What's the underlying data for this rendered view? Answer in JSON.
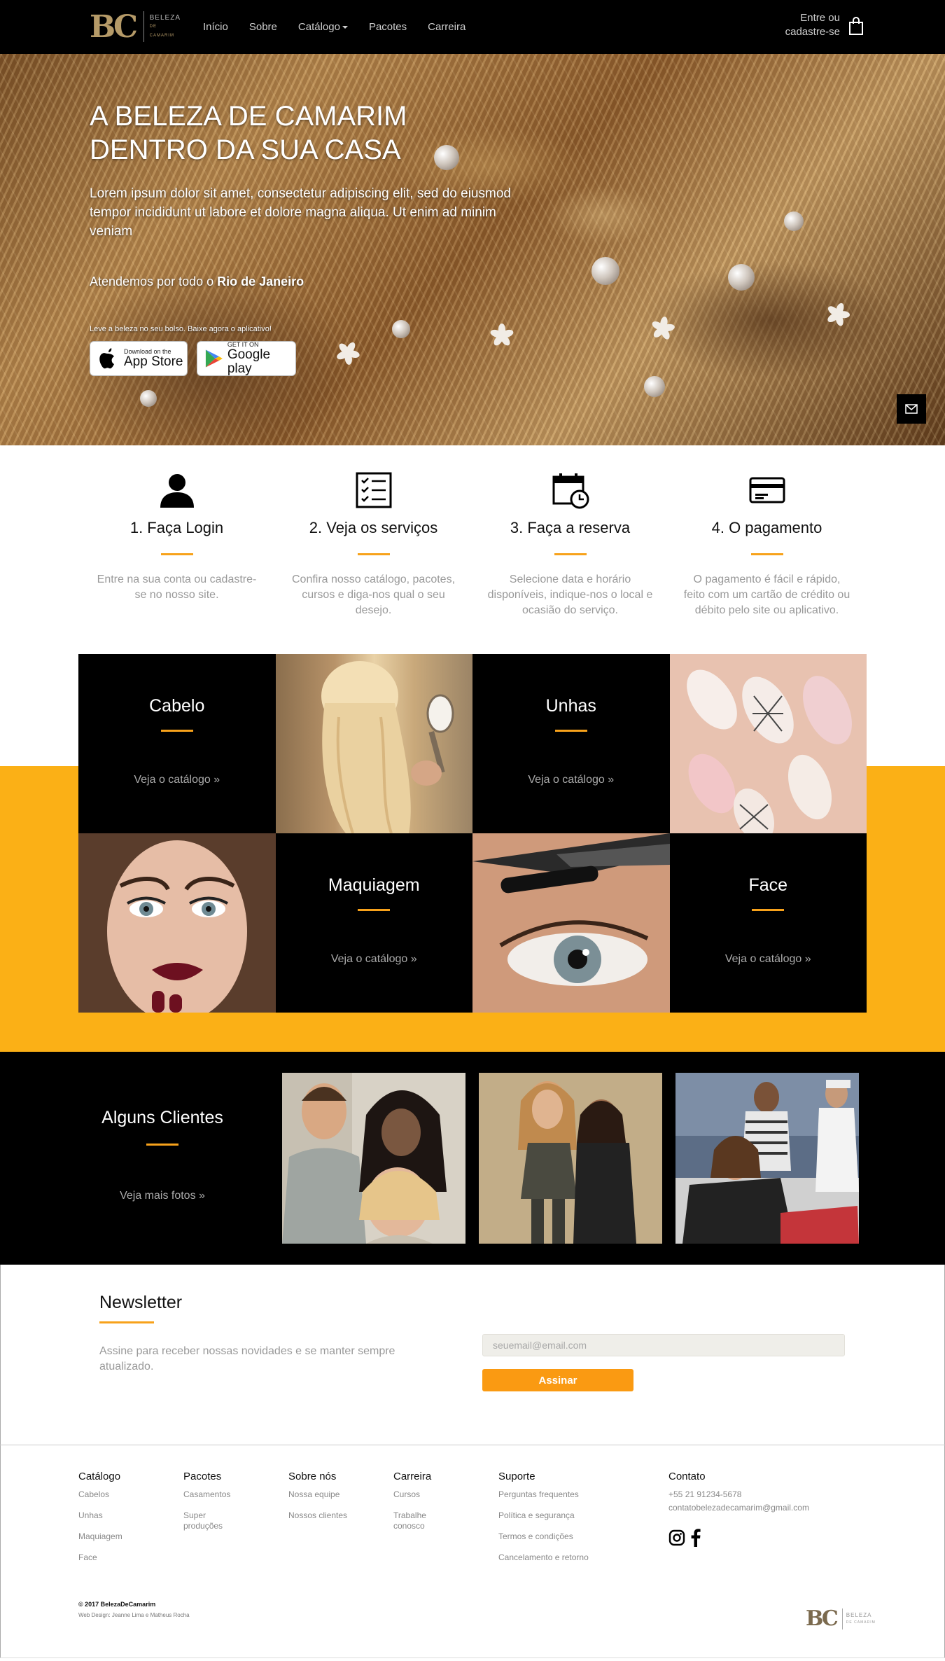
{
  "nav": {
    "logo_mark": "BC",
    "logo_name": "BELEZA",
    "logo_sub": "DE CAMARIM",
    "items": [
      "Início",
      "Sobre",
      "Catálogo",
      "Pacotes",
      "Carreira"
    ],
    "login_line1": "Entre ou",
    "login_line2": "cadastre-se"
  },
  "hero": {
    "title_line1": "A BELEZA DE CAMARIM",
    "title_line2": "DENTRO DA SUA CASA",
    "description": "Lorem ipsum dolor sit amet, consectetur adipiscing elit, sed do eiusmod tempor incididunt ut labore et dolore magna aliqua. Ut enim ad minim veniam",
    "served_prefix": "Atendemos por todo o ",
    "served_place": "Rio de Janeiro",
    "app_text": "Leve a beleza no seu bolso. Baixe agora o aplicativo!",
    "appstore_small": "Download on the",
    "appstore_big": "App Store",
    "google_small": "GET IT ON",
    "google_big": "Google play"
  },
  "steps": [
    {
      "icon": "user-icon",
      "title": "1. Faça Login",
      "text": "Entre na sua conta ou cadastre-se no nosso site."
    },
    {
      "icon": "checklist-icon",
      "title": "2. Veja os serviços",
      "text": "Confira nosso catálogo, pacotes, cursos e diga-nos qual o seu desejo."
    },
    {
      "icon": "calendar-clock-icon",
      "title": "3. Faça a reserva",
      "text": "Selecione data e horário disponíveis, indique-nos o local e ocasião do serviço."
    },
    {
      "icon": "credit-card-icon",
      "title": "4. O pagamento",
      "text": "O pagamento é fácil e rápido, feito com um cartão de crédito ou débito pelo site ou aplicativo."
    }
  ],
  "catalog": [
    {
      "title": "Cabelo",
      "link": "Veja o catálogo »"
    },
    {
      "title": "Unhas",
      "link": "Veja o catálogo »"
    },
    {
      "title": "Maquiagem",
      "link": "Veja o catálogo »"
    },
    {
      "title": "Face",
      "link": "Veja o catálogo »"
    }
  ],
  "clients": {
    "title": "Alguns Clientes",
    "link": "Veja mais fotos »"
  },
  "newsletter": {
    "title": "Newsletter",
    "text": "Assine para receber nossas novidades e se manter sempre atualizado.",
    "placeholder": "seuemail@email.com",
    "button": "Assinar"
  },
  "footer": {
    "columns": [
      {
        "head": "Catálogo",
        "items": [
          "Cabelos",
          "Unhas",
          "Maquiagem",
          "Face"
        ]
      },
      {
        "head": "Pacotes",
        "items": [
          "Casamentos",
          "Super produções"
        ]
      },
      {
        "head": "Sobre nós",
        "items": [
          "Nossa equipe",
          "Nossos clientes"
        ]
      },
      {
        "head": "Carreira",
        "items": [
          "Cursos",
          "Trabalhe conosco"
        ]
      },
      {
        "head": "Suporte",
        "items": [
          "Perguntas frequentes",
          "Política e segurança",
          "Termos e condições",
          "Cancelamento e retorno"
        ]
      }
    ],
    "contact": {
      "head": "Contato",
      "phone": "+55 21 91234-5678",
      "email": "contatobelezadecamarim@gmail.com"
    },
    "copyright": "© 2017 BelezaDeCamarim",
    "credit": "Web Design: Jeanne Lima e Matheus Rocha"
  },
  "colors": {
    "accent": "#f7a21b",
    "band": "#fbb016",
    "dark": "#000000"
  }
}
